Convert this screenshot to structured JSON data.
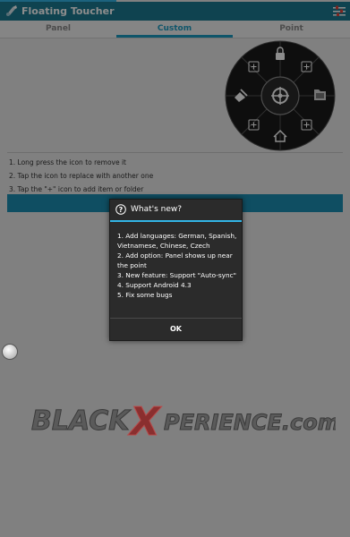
{
  "app": {
    "title": "Floating Toucher"
  },
  "icons": {
    "app": "floating-toucher-app-icon",
    "settings": "settings-sliders-icon"
  },
  "tabs": [
    {
      "label": "Panel"
    },
    {
      "label": "Custom",
      "active": true
    },
    {
      "label": "Point"
    }
  ],
  "wheel": {
    "center": "target-icon",
    "slots": [
      "lock-icon",
      "add-icon",
      "folder-icon",
      "add-icon",
      "home-icon",
      "add-icon",
      "broom-icon",
      "add-icon"
    ]
  },
  "instructions": [
    "1. Long press the icon to remove it",
    "2. Tap the icon to replace with another one",
    "3. Tap the \"+\" icon to add item or folder"
  ],
  "dialog": {
    "title": "What's new?",
    "items": [
      "1. Add languages: German, Spanish, Vietnamese, Chinese, Czech",
      "2. Add option: Panel shows up near the point",
      "3. New feature: Support \"Auto-sync\"",
      "4. Support Android 4.3",
      "5. Fix some bugs"
    ],
    "ok_label": "OK"
  },
  "watermark": {
    "text": "BLACKXPERIENCE.com"
  },
  "colors": {
    "accent": "#1c9cc2",
    "actionbar": "#1c7a93",
    "dialog_rule": "#33b5e5"
  }
}
